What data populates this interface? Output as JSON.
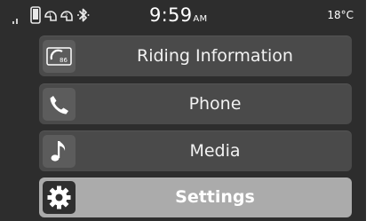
{
  "status_bar": {
    "icons": [
      "signal-icon",
      "phone-connected-icon",
      "helmet-1-icon",
      "helmet-2-icon",
      "bluetooth-icon"
    ],
    "helmet_1_number": "1",
    "helmet_2_number": "2",
    "time": "9:59",
    "time_period": "AM",
    "temperature": "18°C"
  },
  "menu": {
    "items": [
      {
        "label": "Riding Information",
        "icon": "speedometer-icon",
        "icon_text": "86",
        "selected": false
      },
      {
        "label": "Phone",
        "icon": "phone-handset-icon",
        "selected": false
      },
      {
        "label": "Media",
        "icon": "music-note-icon",
        "selected": false
      },
      {
        "label": "Settings",
        "icon": "gear-icon",
        "selected": true
      }
    ]
  },
  "colors": {
    "screen_background": "#2d2d2d",
    "item_background": "#4a4a4a",
    "selected_item_background": "#ababab",
    "text": "#ffffff"
  }
}
